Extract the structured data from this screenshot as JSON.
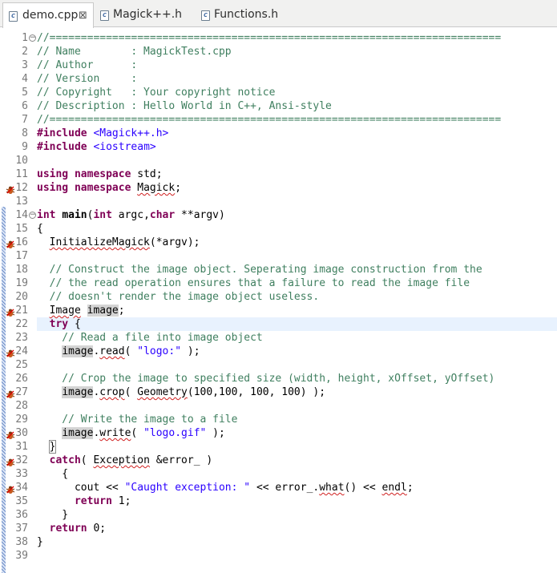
{
  "tabs": [
    {
      "label": "demo.cpp",
      "icon": "c-source-file-icon",
      "active": true,
      "close": "⊠"
    },
    {
      "label": "Magick++.h",
      "icon": "c-header-file-icon",
      "active": false
    },
    {
      "label": "Functions.h",
      "icon": "c-header-file-icon",
      "active": false
    }
  ],
  "file_icon_glyph": "c",
  "lines": [
    {
      "n": "1",
      "tokens": [
        {
          "t": "//========================================================================",
          "c": "cm"
        }
      ],
      "fold": "minus"
    },
    {
      "n": "2",
      "tokens": [
        {
          "t": "// Name        : MagickTest.cpp",
          "c": "cm"
        }
      ]
    },
    {
      "n": "3",
      "tokens": [
        {
          "t": "// Author      :",
          "c": "cm"
        }
      ]
    },
    {
      "n": "4",
      "tokens": [
        {
          "t": "// Version     :",
          "c": "cm"
        }
      ]
    },
    {
      "n": "5",
      "tokens": [
        {
          "t": "// Copyright   : Your copyright notice",
          "c": "cm"
        }
      ]
    },
    {
      "n": "6",
      "tokens": [
        {
          "t": "// Description : Hello World in C++, Ansi-style",
          "c": "cm"
        }
      ]
    },
    {
      "n": "7",
      "tokens": [
        {
          "t": "//========================================================================",
          "c": "cm"
        }
      ]
    },
    {
      "n": "8",
      "tokens": [
        {
          "t": "#include",
          "c": "kw"
        },
        {
          "t": " "
        },
        {
          "t": "<Magick++.h>",
          "c": "inc"
        }
      ]
    },
    {
      "n": "9",
      "tokens": [
        {
          "t": "#include",
          "c": "kw"
        },
        {
          "t": " "
        },
        {
          "t": "<iostream>",
          "c": "inc"
        }
      ]
    },
    {
      "n": "10",
      "tokens": []
    },
    {
      "n": "11",
      "tokens": [
        {
          "t": "using",
          "c": "kw"
        },
        {
          "t": " "
        },
        {
          "t": "namespace",
          "c": "kw"
        },
        {
          "t": " std;"
        }
      ]
    },
    {
      "n": "12",
      "tokens": [
        {
          "t": "using",
          "c": "kw"
        },
        {
          "t": " "
        },
        {
          "t": "namespace",
          "c": "kw"
        },
        {
          "t": " "
        },
        {
          "t": "Magick",
          "c": "squig"
        },
        {
          "t": ";"
        }
      ],
      "bug": true
    },
    {
      "n": "13",
      "tokens": []
    },
    {
      "n": "14",
      "tokens": [
        {
          "t": "int",
          "c": "kw"
        },
        {
          "t": " "
        },
        {
          "t": "main",
          "c": "bold"
        },
        {
          "t": "("
        },
        {
          "t": "int",
          "c": "kw"
        },
        {
          "t": " argc,"
        },
        {
          "t": "char",
          "c": "kw"
        },
        {
          "t": " **argv)"
        }
      ],
      "fold": "minus"
    },
    {
      "n": "15",
      "tokens": [
        {
          "t": "{"
        }
      ]
    },
    {
      "n": "16",
      "tokens": [
        {
          "t": "  "
        },
        {
          "t": "InitializeMagick",
          "c": "squig"
        },
        {
          "t": "(*argv);"
        }
      ],
      "bug": true
    },
    {
      "n": "17",
      "tokens": []
    },
    {
      "n": "18",
      "tokens": [
        {
          "t": "  // Construct the image object. Seperating image construction from the",
          "c": "cm"
        }
      ]
    },
    {
      "n": "19",
      "tokens": [
        {
          "t": "  // the read operation ensures that a failure to read the image file",
          "c": "cm"
        }
      ]
    },
    {
      "n": "20",
      "tokens": [
        {
          "t": "  // doesn't render the image object useless.",
          "c": "cm"
        }
      ]
    },
    {
      "n": "21",
      "tokens": [
        {
          "t": "  "
        },
        {
          "t": "Image",
          "c": "squig"
        },
        {
          "t": " "
        },
        {
          "t": "image",
          "c": "hl"
        },
        {
          "t": ";"
        }
      ],
      "bug": true
    },
    {
      "n": "22",
      "tokens": [
        {
          "t": "  "
        },
        {
          "t": "try",
          "c": "kw"
        },
        {
          "t": " {"
        }
      ],
      "current": true
    },
    {
      "n": "23",
      "tokens": [
        {
          "t": "    // Read a file into image object",
          "c": "cm"
        }
      ]
    },
    {
      "n": "24",
      "tokens": [
        {
          "t": "    "
        },
        {
          "t": "image",
          "c": "hl"
        },
        {
          "t": "."
        },
        {
          "t": "read",
          "c": "squig"
        },
        {
          "t": "( "
        },
        {
          "t": "\"logo:\"",
          "c": "str"
        },
        {
          "t": " );"
        }
      ],
      "bug": true
    },
    {
      "n": "25",
      "tokens": []
    },
    {
      "n": "26",
      "tokens": [
        {
          "t": "    // Crop the image to specified size (width, height, xOffset, yOffset)",
          "c": "cm"
        }
      ]
    },
    {
      "n": "27",
      "tokens": [
        {
          "t": "    "
        },
        {
          "t": "image",
          "c": "hl"
        },
        {
          "t": "."
        },
        {
          "t": "crop",
          "c": "squig"
        },
        {
          "t": "( "
        },
        {
          "t": "Geometry",
          "c": "squig"
        },
        {
          "t": "(100,100, 100, 100) );"
        }
      ],
      "bug": true
    },
    {
      "n": "28",
      "tokens": []
    },
    {
      "n": "29",
      "tokens": [
        {
          "t": "    // Write the image to a file",
          "c": "cm"
        }
      ]
    },
    {
      "n": "30",
      "tokens": [
        {
          "t": "    "
        },
        {
          "t": "image",
          "c": "hl"
        },
        {
          "t": "."
        },
        {
          "t": "write",
          "c": "squig"
        },
        {
          "t": "( "
        },
        {
          "t": "\"logo.gif\"",
          "c": "str"
        },
        {
          "t": " );"
        }
      ],
      "bug": true
    },
    {
      "n": "31",
      "tokens": [
        {
          "t": "  "
        },
        {
          "t": "}",
          "c": "brace"
        }
      ]
    },
    {
      "n": "32",
      "tokens": [
        {
          "t": "  "
        },
        {
          "t": "catch",
          "c": "kw"
        },
        {
          "t": "( "
        },
        {
          "t": "Exception",
          "c": "squig"
        },
        {
          "t": " &error_ )"
        }
      ],
      "bug": true
    },
    {
      "n": "33",
      "tokens": [
        {
          "t": "    {"
        }
      ]
    },
    {
      "n": "34",
      "tokens": [
        {
          "t": "      cout << "
        },
        {
          "t": "\"Caught exception: \"",
          "c": "str"
        },
        {
          "t": " << error_."
        },
        {
          "t": "what",
          "c": "squig"
        },
        {
          "t": "() << "
        },
        {
          "t": "endl",
          "c": "squig"
        },
        {
          "t": ";"
        }
      ],
      "bug": true
    },
    {
      "n": "35",
      "tokens": [
        {
          "t": "      "
        },
        {
          "t": "return",
          "c": "kw"
        },
        {
          "t": " 1;"
        }
      ]
    },
    {
      "n": "36",
      "tokens": [
        {
          "t": "    }"
        }
      ]
    },
    {
      "n": "37",
      "tokens": [
        {
          "t": "  "
        },
        {
          "t": "return",
          "c": "kw"
        },
        {
          "t": " 0;"
        }
      ]
    },
    {
      "n": "38",
      "tokens": [
        {
          "t": "}"
        }
      ]
    },
    {
      "n": "39",
      "tokens": []
    }
  ],
  "colors": {
    "comment": "#3f7f5f",
    "keyword": "#7f0055",
    "string": "#2a00ff",
    "current_line": "#e8f2fe",
    "line_number": "#787878"
  }
}
